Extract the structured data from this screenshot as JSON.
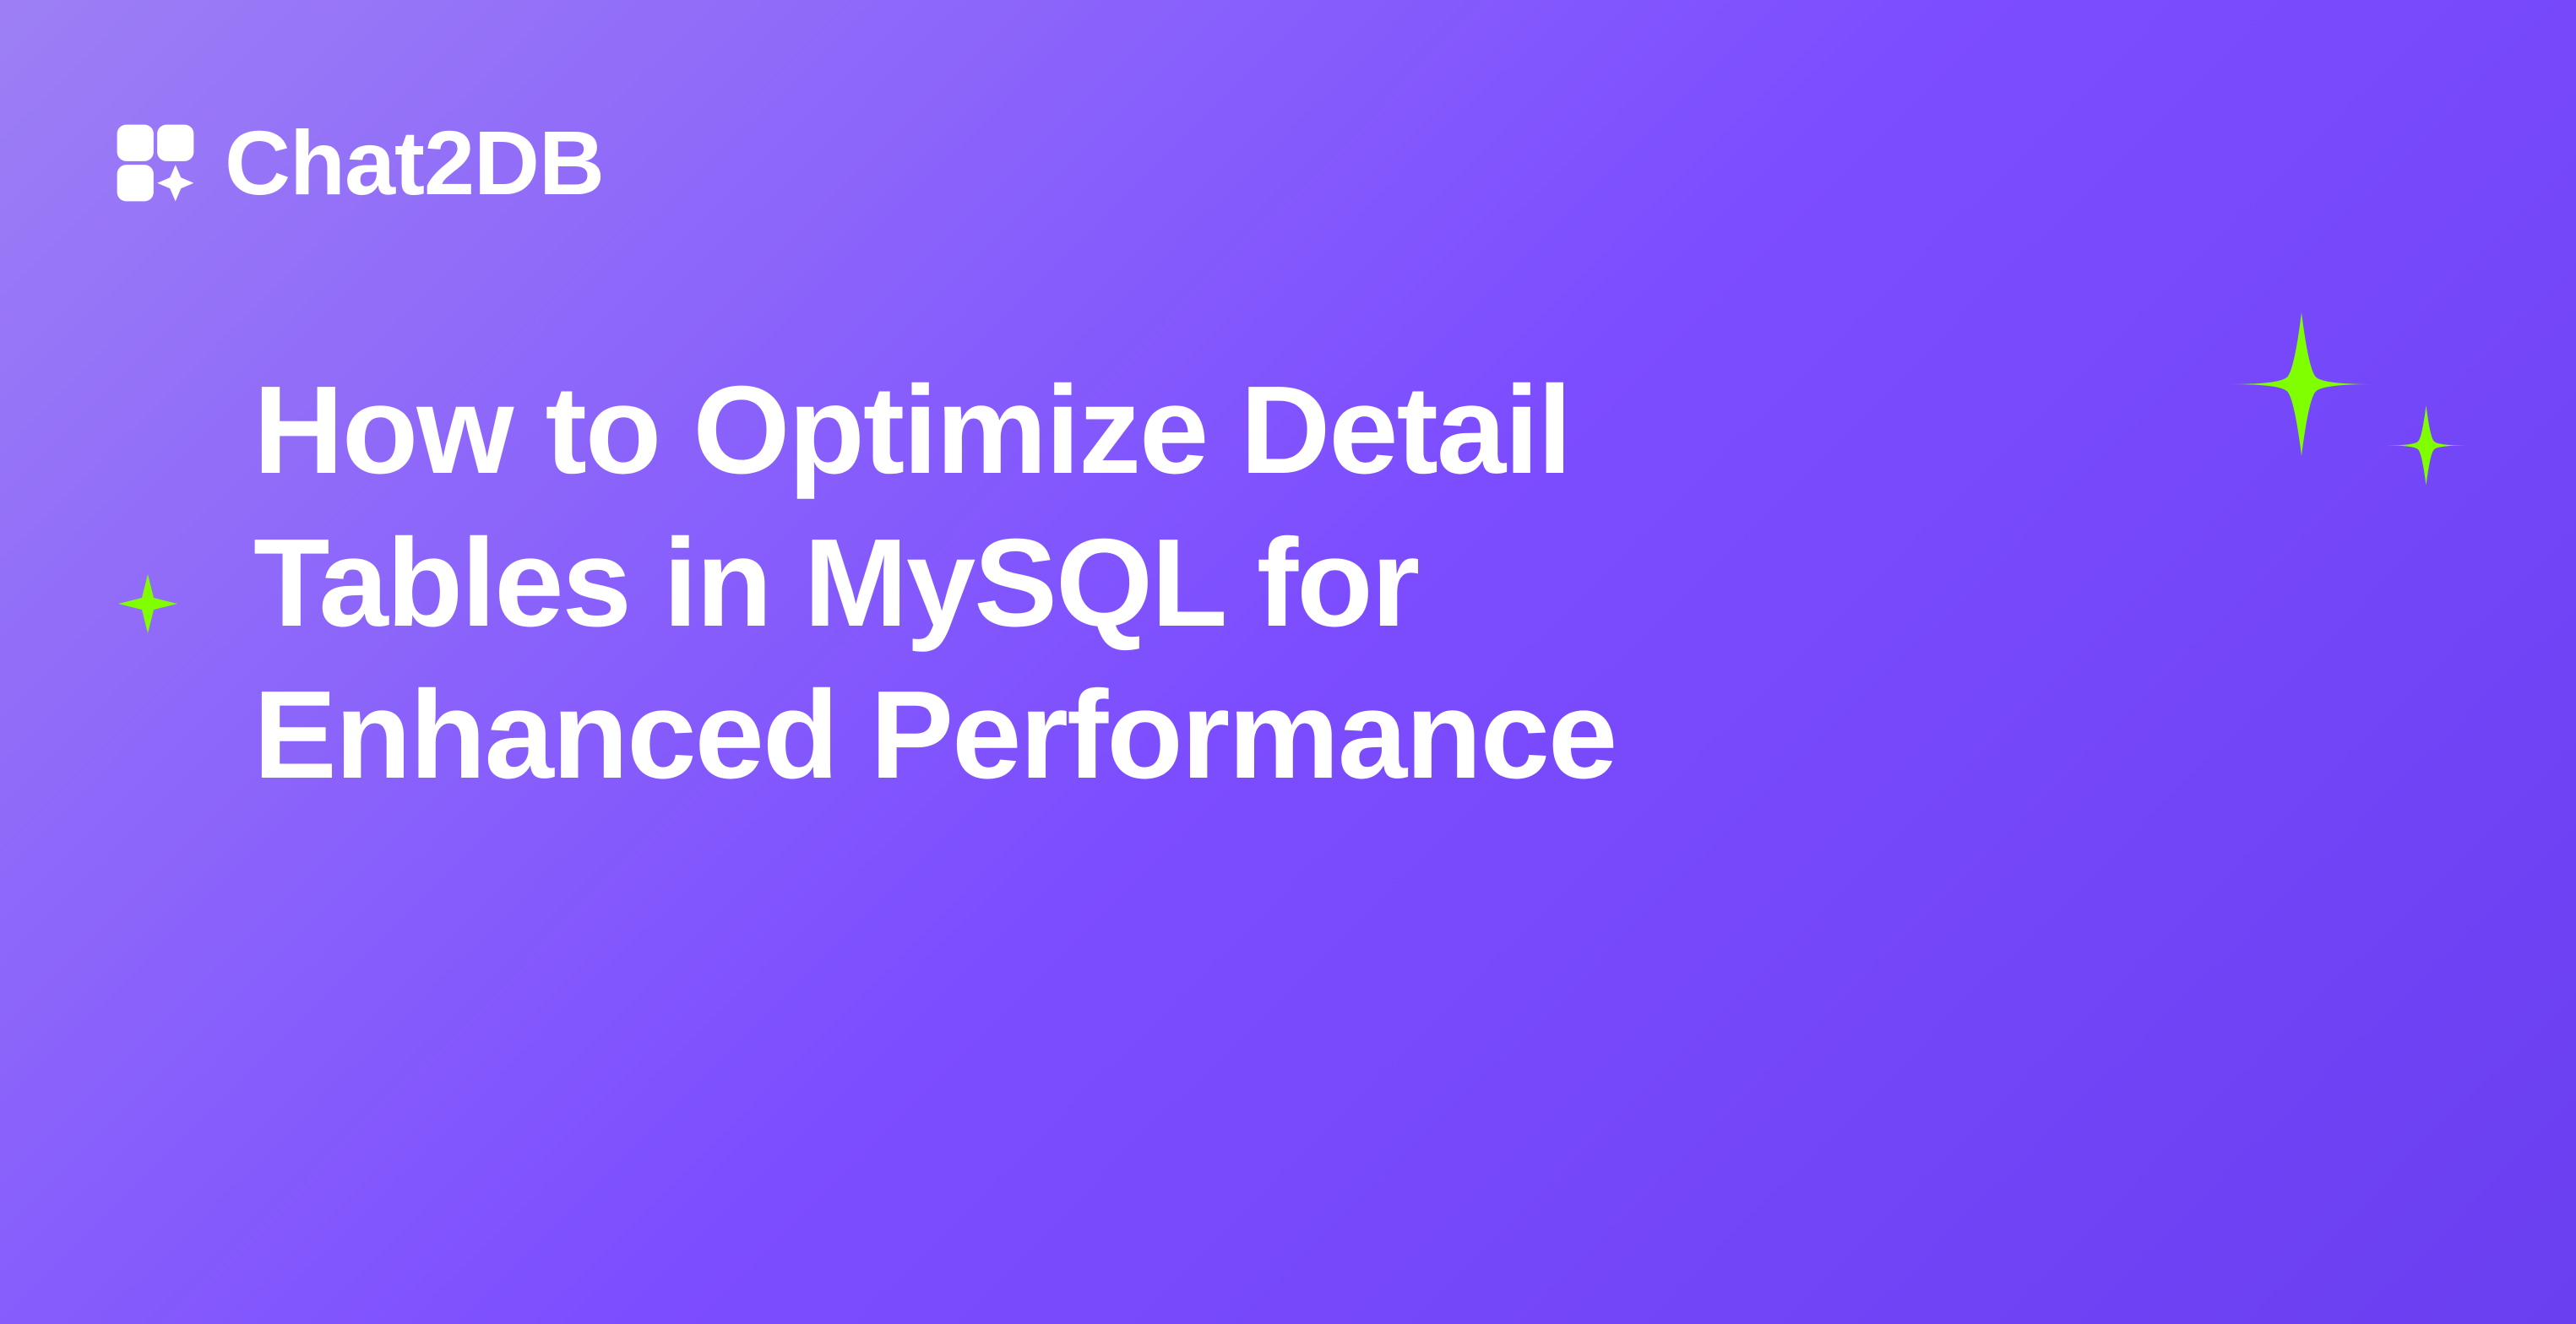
{
  "brand": {
    "name": "Chat2DB"
  },
  "title": "How to Optimize Detail Tables in MySQL for Enhanced Performance",
  "colors": {
    "background_start": "#9d7ff5",
    "background_end": "#6a3ff0",
    "text": "#ffffff",
    "accent_sparkle": "#7fff00"
  }
}
